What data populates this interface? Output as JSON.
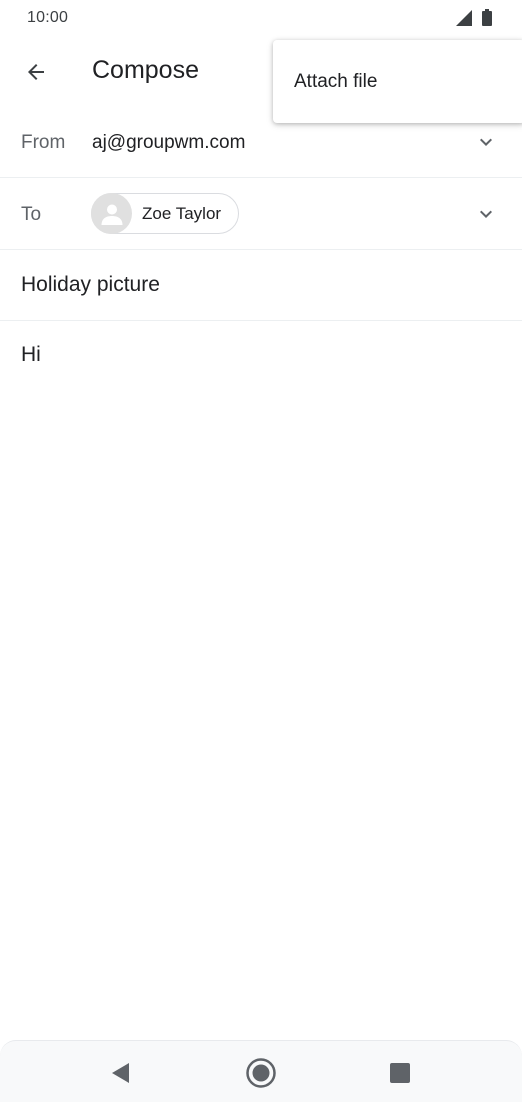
{
  "status_bar": {
    "time": "10:00",
    "icons": [
      "signal-icon",
      "battery-icon"
    ]
  },
  "app_bar": {
    "title": "Compose",
    "back_icon": "arrow-back-icon"
  },
  "overflow_menu": {
    "items": [
      {
        "label": "Attach file"
      }
    ]
  },
  "compose": {
    "from": {
      "label": "From",
      "value": "aj@groupwm.com",
      "icon": "chevron-down-icon"
    },
    "to": {
      "label": "To",
      "recipients": [
        {
          "name": "Zoe Taylor",
          "avatar_icon": "person-icon"
        }
      ],
      "icon": "chevron-down-icon"
    },
    "subject": {
      "value": "Holiday picture"
    },
    "body": {
      "value": "Hi"
    }
  },
  "nav_bar": {
    "buttons": [
      "nav-back-icon",
      "nav-home-icon",
      "nav-recents-icon"
    ]
  },
  "colors": {
    "text_primary": "#202124",
    "text_secondary": "#5f6368",
    "icon": "#5f6368",
    "divider": "#eceff1",
    "avatar_bg": "#e0e0e0"
  }
}
